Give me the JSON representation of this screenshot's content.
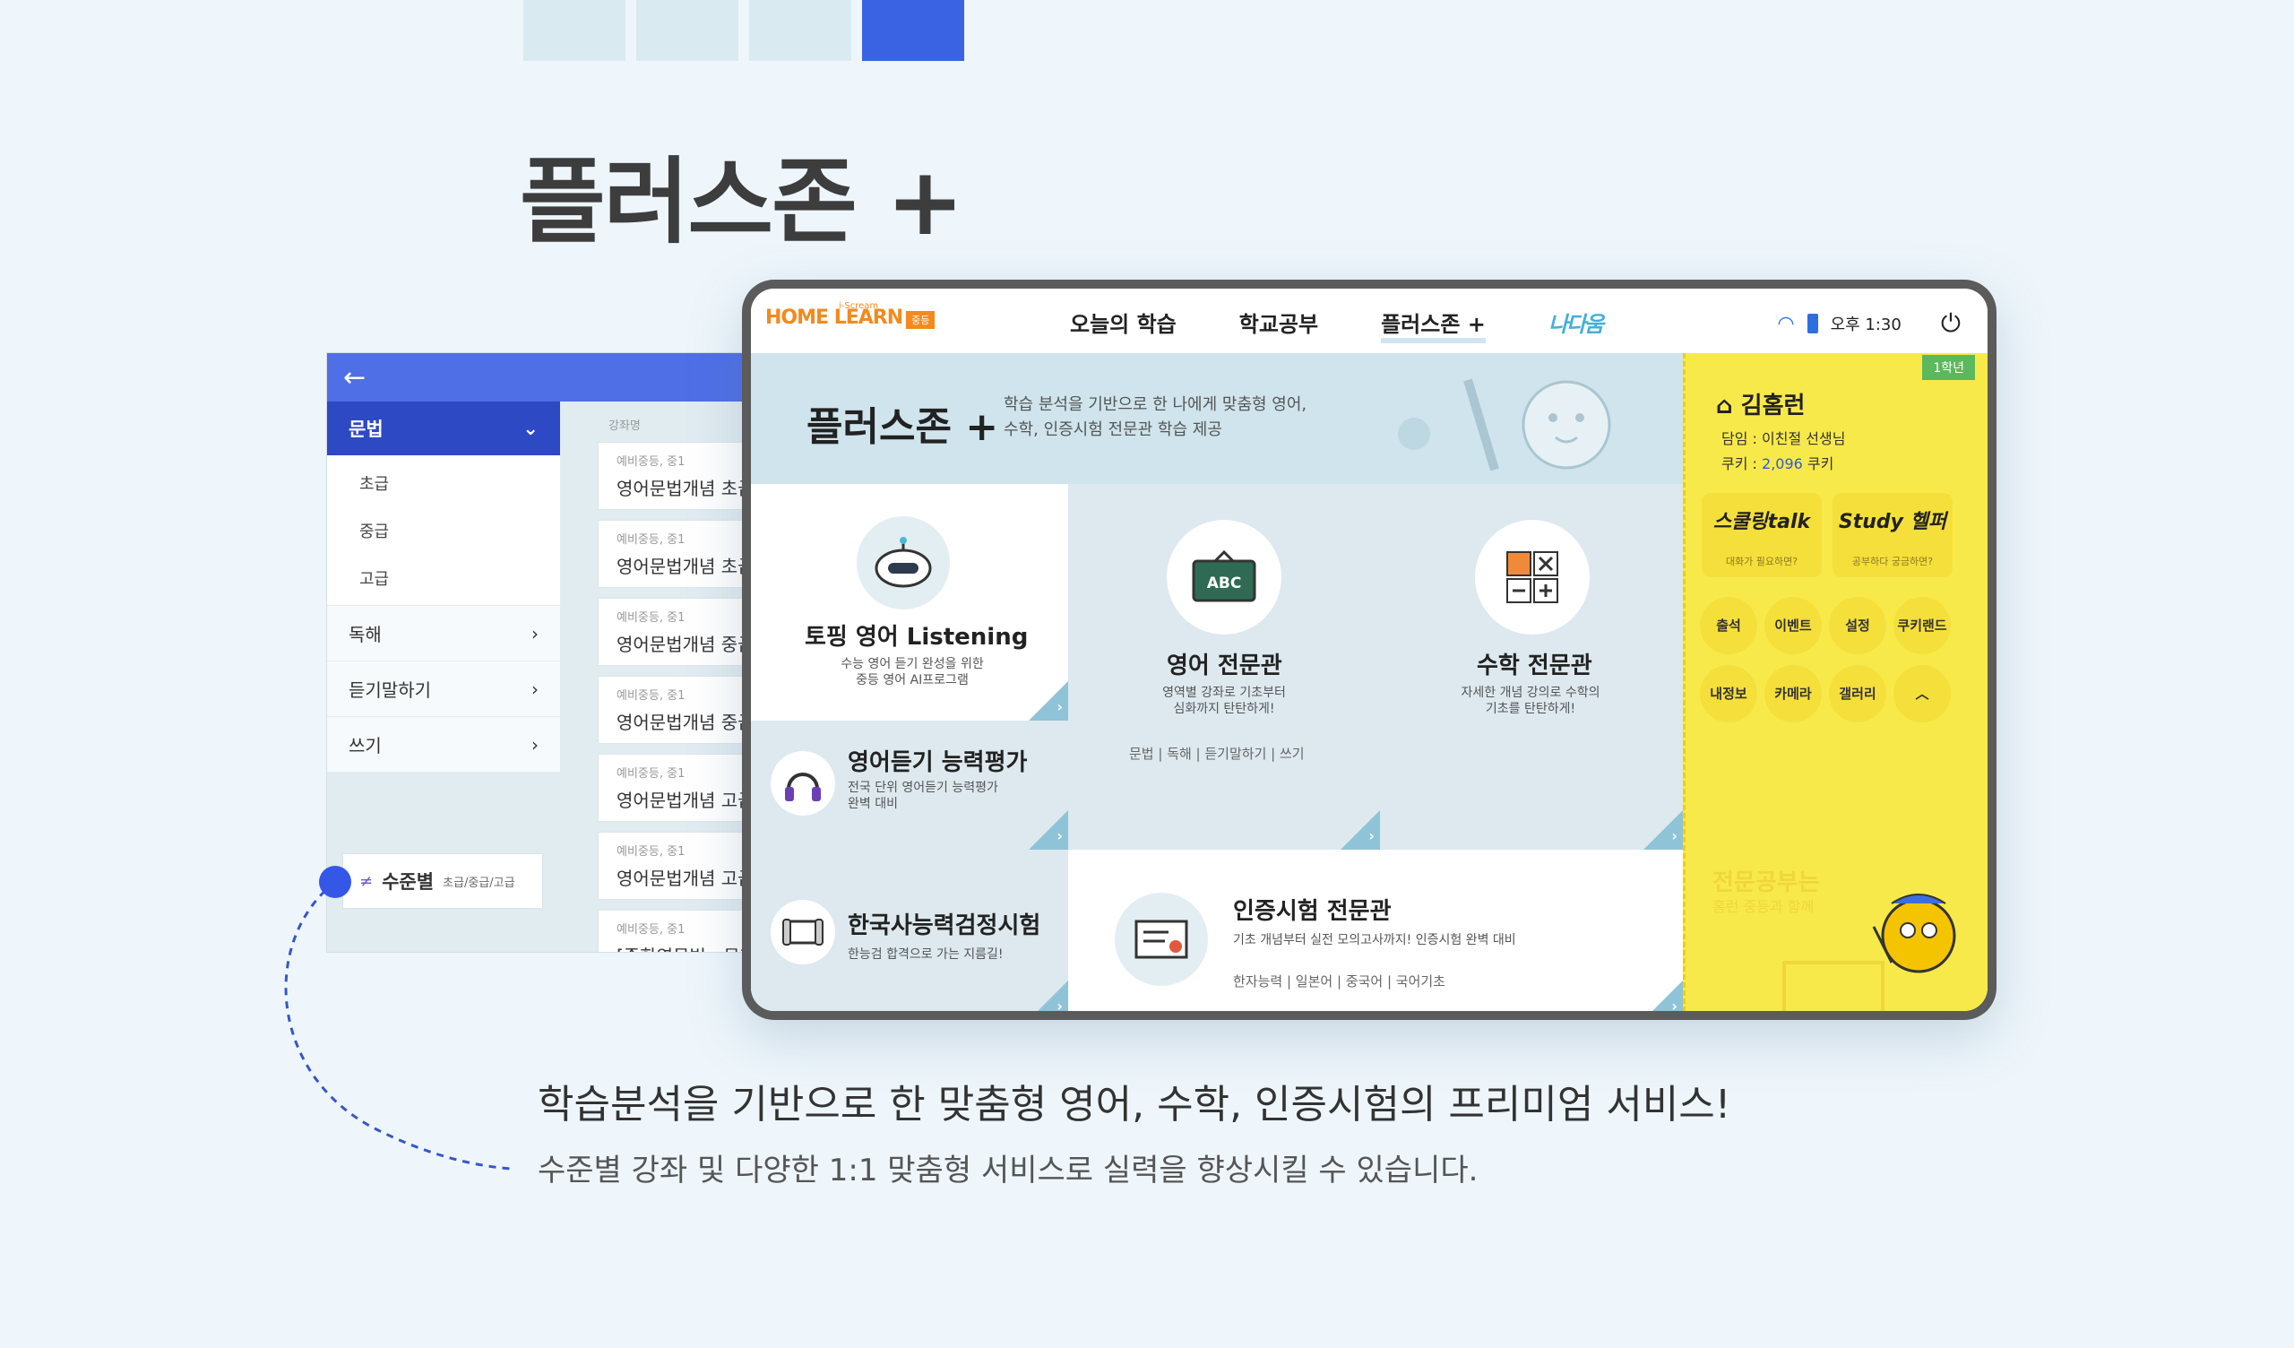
{
  "page": {
    "title": "플러스존 +",
    "headline": "학습분석을 기반으로 한 맞춤형 영어, 수학, 인증시험의 프리미엄 서비스!",
    "subline": "수준별 강좌 및 다양한 1:1 맞춤형 서비스로 실력을 향상시킬 수 있습니다."
  },
  "left_panel": {
    "open_menu": "문법",
    "sub_items": [
      "초급",
      "중급",
      "고급"
    ],
    "items": [
      "독해",
      "듣기말하기",
      "쓰기"
    ],
    "list_header": "강좌명",
    "courses": [
      {
        "tag": "예비중등, 중1",
        "name": "영어문법개념 초급"
      },
      {
        "tag": "예비중등, 중1",
        "name": "영어문법개념 초급"
      },
      {
        "tag": "예비중등, 중1",
        "name": "영어문법개념 중급"
      },
      {
        "tag": "예비중등, 중1",
        "name": "영어문법개념 중급"
      },
      {
        "tag": "예비중등, 중1",
        "name": "영어문법개념 고급"
      },
      {
        "tag": "예비중등, 중1",
        "name": "영어문법개념 고급"
      },
      {
        "tag": "예비중등, 중1",
        "name": "[종합영문법 : 문제"
      }
    ],
    "level_badge": {
      "main": "수준별",
      "sub": "초급/중급/고급"
    }
  },
  "topbar": {
    "logo_small": "i-Scream",
    "logo_main": "HOME LEARN",
    "logo_badge": "중등",
    "nav": [
      "오늘의 학습",
      "학교공부",
      "플러스존 +",
      "나다움"
    ],
    "time": "오후 1:30"
  },
  "hero": {
    "title": "플러스존 +",
    "desc_1": "학습 분석을 기반으로 한 나에게 맞춤형 영어,",
    "desc_2": "수학, 인증시험 전문관 학습 제공"
  },
  "tiles": {
    "topping": {
      "title": "토핑 영어 Listening",
      "sub_1": "수능 영어 듣기 완성을 위한",
      "sub_2": "중등 영어 AI프로그램"
    },
    "english": {
      "title": "영어 전문관",
      "sub_1": "영역별 강좌로 기초부터",
      "sub_2": "심화까지 탄탄하게!",
      "links": "문법 | 독해 | 듣기말하기 | 쓰기",
      "icon_text": "ABC"
    },
    "math": {
      "title": "수학 전문관",
      "sub_1": "자세한 개념 강의로 수학의",
      "sub_2": "기초를 탄탄하게!"
    },
    "listening": {
      "title": "영어듣기 능력평가",
      "sub_1": "전국 단위 영어듣기 능력평가",
      "sub_2": "완벽 대비"
    },
    "history": {
      "title": "한국사능력검정시험",
      "sub": "한능검 합격으로 가는 지름길!"
    },
    "cert": {
      "title": "인증시험 전문관",
      "sub": "기초 개념부터 실전 모의고사까지! 인증시험 완벽 대비",
      "links": "한자능력 | 일본어 | 중국어 | 국어기초"
    }
  },
  "sidebar": {
    "grade": "1학년",
    "name": "김홈런",
    "teacher_label": "담임 :",
    "teacher": "이친절 선생님",
    "cookie_label": "쿠키 :",
    "cookie_value": "2,096",
    "cookie_unit": "쿠키",
    "card1": {
      "big": "스쿨링talk",
      "cap": "대화가 필요하면?"
    },
    "card2": {
      "big": "Study 헬퍼",
      "cap": "공부하다 궁금하면?"
    },
    "buttons": [
      "출석",
      "이벤트",
      "설정",
      "쿠키랜드",
      "내정보",
      "카메라",
      "갤러리",
      "︿"
    ],
    "ghost_1": "전문공부는",
    "ghost_2": "홈런 중등과 함께"
  },
  "colors": {
    "accent": "#3a63e4",
    "sidebar": "#f8e94a",
    "tile": "#dde9ef"
  }
}
